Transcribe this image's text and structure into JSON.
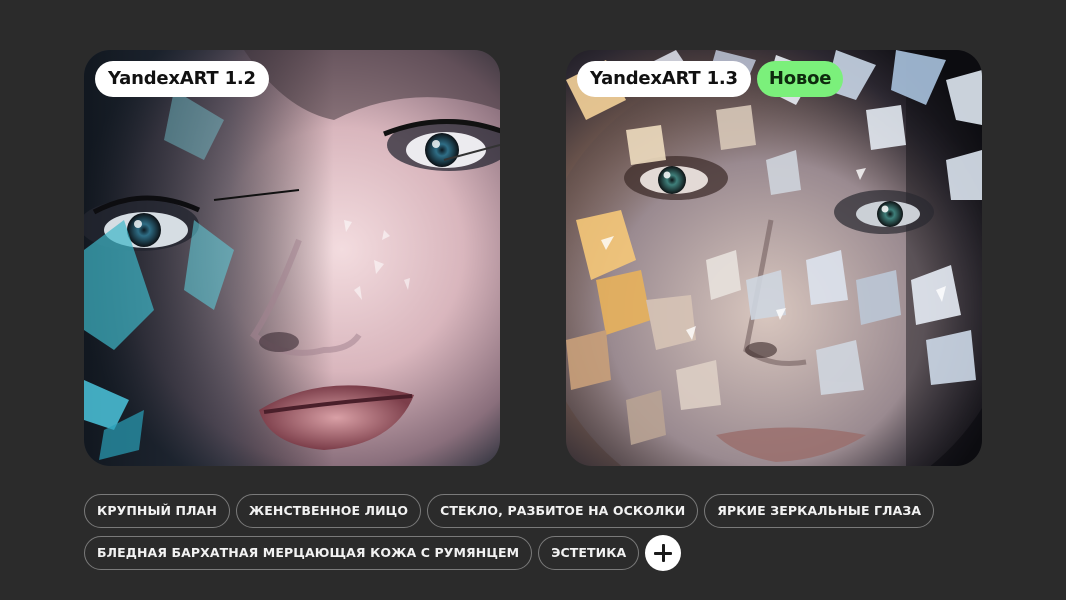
{
  "cards": [
    {
      "model_label": "YandexART 1.2",
      "image_description": "portrait-cracked-glass-teal"
    },
    {
      "model_label": "YandexART 1.3",
      "new_badge": "Новое",
      "image_description": "portrait-mirror-shards-warm"
    }
  ],
  "tags": {
    "row1": [
      "КРУПНЫЙ ПЛАН",
      "ЖЕНСТВЕННОЕ ЛИЦО",
      "СТЕКЛО, РАЗБИТОЕ НА ОСКОЛКИ",
      "ЯРКИЕ ЗЕРКАЛЬНЫЕ ГЛАЗА"
    ],
    "row2": [
      "БЛЕДНАЯ БАРХАТНАЯ МЕРЦАЮЩАЯ КОЖА С РУМЯНЦЕМ",
      "ЭСТЕТИКА"
    ]
  },
  "add_button_icon": "plus-icon",
  "colors": {
    "background": "#2b2b2b",
    "badge": "#ffffff",
    "new_badge": "#7bf07b",
    "tag_border": "#7a7a7a"
  }
}
